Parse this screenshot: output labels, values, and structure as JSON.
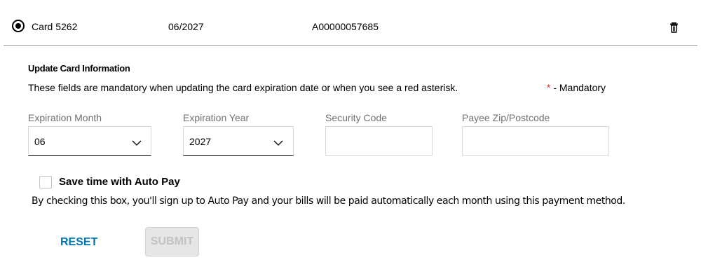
{
  "card": {
    "name": "Card 5262",
    "expiration": "06/2027",
    "account_id": "A00000057685",
    "selected": true
  },
  "update_section": {
    "title": "Update Card Information",
    "description": "These fields are mandatory when updating the card expiration date or when you see a red asterisk.",
    "mandatory_asterisk": "*",
    "mandatory_label": " - Mandatory",
    "asterisk_color": "#d52b1e"
  },
  "fields": {
    "expiration_month": {
      "label": "Expiration Month",
      "value": "06"
    },
    "expiration_year": {
      "label": "Expiration Year",
      "value": "2027"
    },
    "security_code": {
      "label": "Security Code",
      "value": ""
    },
    "payee_zip": {
      "label": "Payee Zip/Postcode",
      "value": ""
    }
  },
  "auto_pay": {
    "label": "Save time with Auto Pay",
    "checked": false,
    "description": "By checking this box, you'll sign up to Auto Pay and your bills will be paid automatically each month using this payment method."
  },
  "actions": {
    "reset_label": "RESET",
    "submit_label": "SUBMIT",
    "submit_enabled": false,
    "link_color": "#0077b4"
  },
  "icons": {
    "radio": "radio-selected-icon",
    "trash": "trash-icon",
    "chevron": "chevron-down-icon",
    "checkbox": "checkbox-unchecked-icon"
  }
}
